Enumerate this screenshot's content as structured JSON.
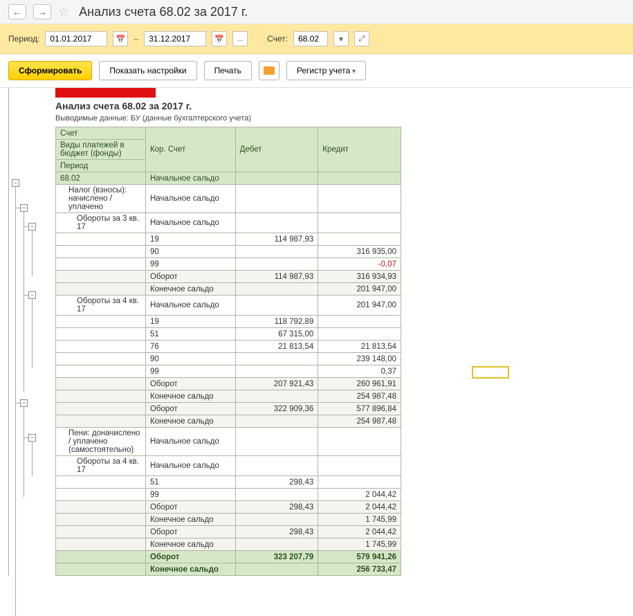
{
  "header": {
    "title": "Анализ счета 68.02 за 2017 г."
  },
  "params": {
    "period_label": "Период:",
    "date_from": "01.01.2017",
    "date_to": "31.12.2017",
    "ellipsis": "...",
    "account_label": "Счет:",
    "account_value": "68.02"
  },
  "toolbar": {
    "generate": "Сформировать",
    "show_settings": "Показать настройки",
    "print": "Печать",
    "register": "Регистр учета"
  },
  "report": {
    "title": "Анализ счета 68.02 за 2017 г.",
    "subtitle": "Выводимые данные:  БУ (данные бухгалтерского учета)",
    "headers": {
      "account": "Счет",
      "cor_account": "Кор. Счет",
      "debit": "Дебет",
      "credit": "Кредит",
      "payment_types": "Виды платежей в бюджет (фонды)",
      "period": "Период"
    },
    "rows": [
      {
        "acc": "68.02",
        "cor": "Начальное сальдо",
        "deb": "",
        "cred": "",
        "bgHdr": true
      },
      {
        "acc": "Налог (взносы): начислено / уплачено",
        "cor": "Начальное сальдо",
        "deb": "",
        "cred": "",
        "ind": 1,
        "wrap": true
      },
      {
        "acc": "Обороты за 3 кв. 17",
        "cor": "Начальное сальдо",
        "deb": "",
        "cred": "",
        "ind": 2
      },
      {
        "acc": "",
        "cor": "19",
        "deb": "114 987,93",
        "cred": "",
        "ind": 2
      },
      {
        "acc": "",
        "cor": "90",
        "deb": "",
        "cred": "316 935,00",
        "ind": 2
      },
      {
        "acc": "",
        "cor": "99",
        "deb": "",
        "cred": "-0,07",
        "ind": 2,
        "neg": true
      },
      {
        "acc": "",
        "cor": "Оборот",
        "deb": "114 987,93",
        "cred": "316 934,93",
        "ind": 2,
        "gray": true
      },
      {
        "acc": "",
        "cor": "Конечное сальдо",
        "deb": "",
        "cred": "201 947,00",
        "ind": 2,
        "gray": true
      },
      {
        "acc": "Обороты за 4 кв. 17",
        "cor": "Начальное сальдо",
        "deb": "",
        "cred": "201 947,00",
        "ind": 2
      },
      {
        "acc": "",
        "cor": "19",
        "deb": "118 792,89",
        "cred": "",
        "ind": 2
      },
      {
        "acc": "",
        "cor": "51",
        "deb": "67 315,00",
        "cred": "",
        "ind": 2
      },
      {
        "acc": "",
        "cor": "76",
        "deb": "21 813,54",
        "cred": "21 813,54",
        "ind": 2
      },
      {
        "acc": "",
        "cor": "90",
        "deb": "",
        "cred": "239 148,00",
        "ind": 2
      },
      {
        "acc": "",
        "cor": "99",
        "deb": "",
        "cred": "0,37",
        "ind": 2
      },
      {
        "acc": "",
        "cor": "Оборот",
        "deb": "207 921,43",
        "cred": "260 961,91",
        "ind": 2,
        "gray": true
      },
      {
        "acc": "",
        "cor": "Конечное сальдо",
        "deb": "",
        "cred": "254 987,48",
        "ind": 2,
        "gray": true
      },
      {
        "acc": "",
        "cor": "Оборот",
        "deb": "322 909,36",
        "cred": "577 896,84",
        "ind": 1,
        "gray": true
      },
      {
        "acc": "",
        "cor": "Конечное сальдо",
        "deb": "",
        "cred": "254 987,48",
        "ind": 1,
        "gray": true
      },
      {
        "acc": "Пени: доначислено / уплачено (самостоятельно)",
        "cor": "Начальное сальдо",
        "deb": "",
        "cred": "",
        "ind": 1,
        "wrap": true
      },
      {
        "acc": "Обороты за 4 кв. 17",
        "cor": "Начальное сальдо",
        "deb": "",
        "cred": "",
        "ind": 2
      },
      {
        "acc": "",
        "cor": "51",
        "deb": "298,43",
        "cred": "",
        "ind": 2
      },
      {
        "acc": "",
        "cor": "99",
        "deb": "",
        "cred": "2 044,42",
        "ind": 2
      },
      {
        "acc": "",
        "cor": "Оборот",
        "deb": "298,43",
        "cred": "2 044,42",
        "ind": 2,
        "gray": true
      },
      {
        "acc": "",
        "cor": "Конечное сальдо",
        "deb": "",
        "cred": "1 745,99",
        "ind": 2,
        "gray": true
      },
      {
        "acc": "",
        "cor": "Оборот",
        "deb": "298,43",
        "cred": "2 044,42",
        "ind": 1,
        "gray": true
      },
      {
        "acc": "",
        "cor": "Конечное сальдо",
        "deb": "",
        "cred": "1 745,99",
        "ind": 1,
        "gray": true
      },
      {
        "acc": "",
        "cor": "Оборот",
        "deb": "323 207,79",
        "cred": "579 941,26",
        "bold": true,
        "bgHdr": true
      },
      {
        "acc": "",
        "cor": "Конечное сальдо",
        "deb": "",
        "cred": "256 733,47",
        "bold": true,
        "bgHdr": true
      }
    ]
  }
}
